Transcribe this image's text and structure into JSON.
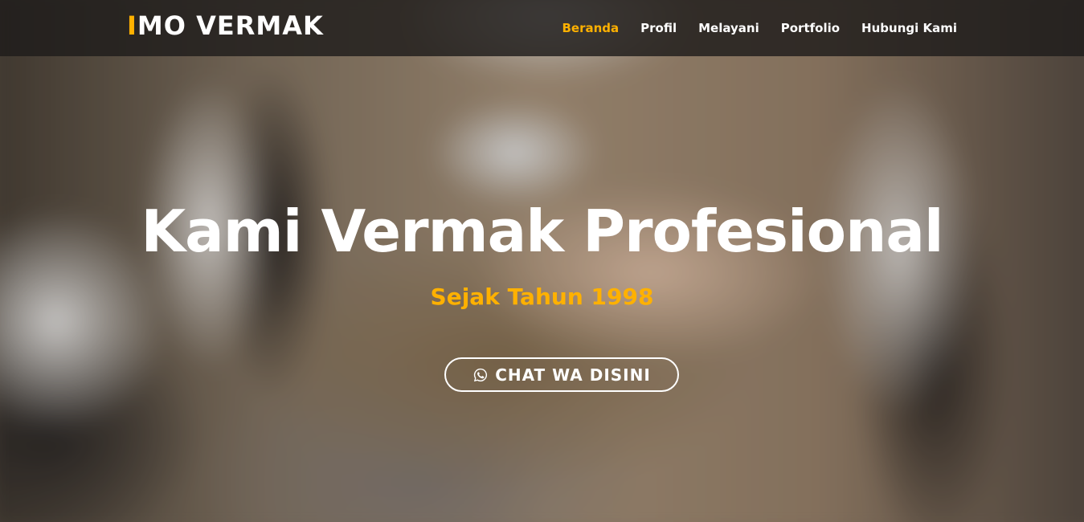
{
  "brand": {
    "logo_accent": "I",
    "logo_rest": "MO VERMAK",
    "accent_color": "#ffb100"
  },
  "nav": {
    "items": [
      {
        "label": "Beranda",
        "active": true
      },
      {
        "label": "Profil",
        "active": false
      },
      {
        "label": "Melayani",
        "active": false
      },
      {
        "label": "Portfolio",
        "active": false
      },
      {
        "label": "Hubungi Kami",
        "active": false
      }
    ]
  },
  "hero": {
    "headline": "Kami Vermak Profesional",
    "subheadline": "Sejak Tahun 1998",
    "cta_label": "CHAT WA DISINI",
    "cta_icon": "whatsapp-icon",
    "background": "sewing machine close-up photo"
  }
}
